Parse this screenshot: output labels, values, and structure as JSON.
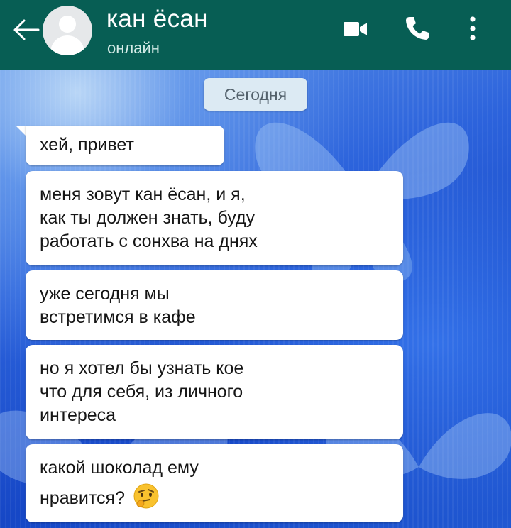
{
  "header": {
    "contact_name": "кан ёсан",
    "status": "онлайн",
    "icons": [
      "back-arrow-icon",
      "avatar",
      "video-call-icon",
      "voice-call-icon",
      "more-vert-icon"
    ],
    "colors": {
      "bar": "#075e54",
      "text": "#ffffff"
    }
  },
  "chat": {
    "date_label": "Сегодня",
    "messages": [
      {
        "lines": [
          "хей, привет"
        ]
      },
      {
        "lines": [
          "меня зовут кан ёсан, и я,",
          "как ты должен знать, буду",
          "работать с сонхва на днях"
        ]
      },
      {
        "lines": [
          "уже сегодня мы",
          "встретимся в кафе"
        ]
      },
      {
        "lines": [
          "но я хотел бы узнать кое",
          "что для себя, из личного",
          "интереса"
        ]
      },
      {
        "lines": [
          "какой шоколад ему",
          "нравится?"
        ],
        "emoji": "thinking-face-emoji"
      }
    ]
  }
}
